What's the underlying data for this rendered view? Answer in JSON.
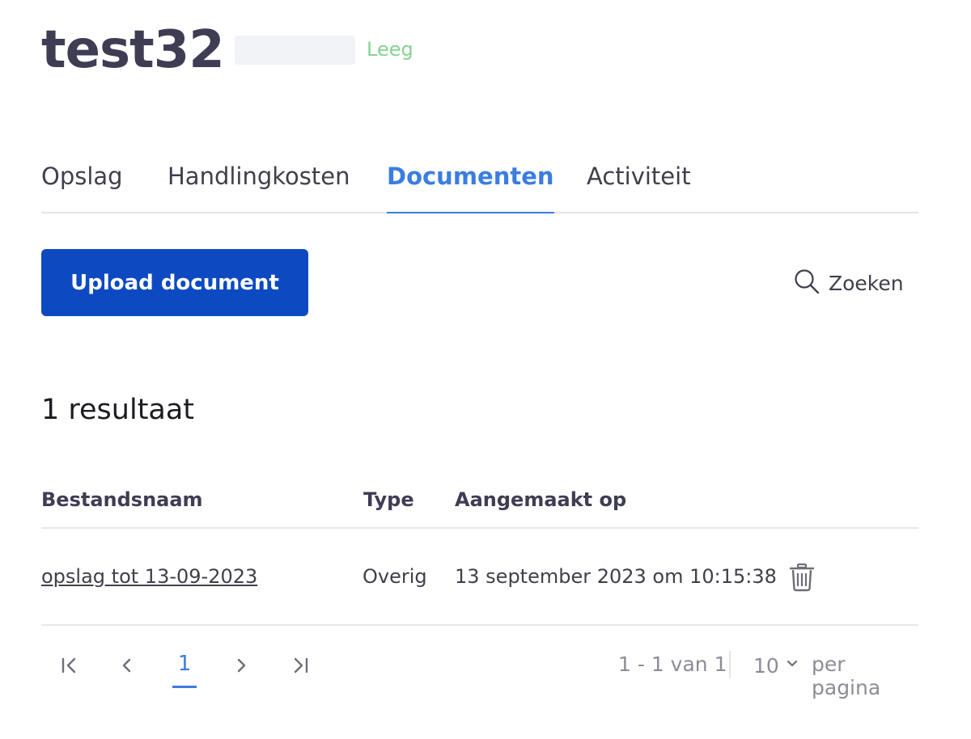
{
  "header": {
    "title": "test32",
    "status": "Leeg"
  },
  "tabs": [
    {
      "label": "Opslag",
      "active": false
    },
    {
      "label": "Handlingkosten",
      "active": false
    },
    {
      "label": "Documenten",
      "active": true
    },
    {
      "label": "Activiteit",
      "active": false
    }
  ],
  "toolbar": {
    "upload_label": "Upload document",
    "search_label": "Zoeken",
    "search_icon": "search-icon"
  },
  "results": {
    "count_label": "1 resultaat"
  },
  "table": {
    "columns": [
      "Bestandsnaam",
      "Type",
      "Aangemaakt op"
    ],
    "rows": [
      {
        "filename": "opslag tot 13-09-2023",
        "type": "Overig",
        "created": "13 september 2023 om 10:15:38",
        "action_icon": "trash-icon"
      }
    ]
  },
  "pagination": {
    "current_page": "1",
    "range_text": "1 - 1 van 1",
    "page_size": "10",
    "per_page_label": "per pagina",
    "icons": [
      "first-page-icon",
      "prev-page-icon",
      "next-page-icon",
      "last-page-icon",
      "chevron-down-icon"
    ]
  },
  "colors": {
    "primary": "#0d4ac2",
    "accent": "#3b7de0",
    "status_green": "#86d391",
    "text": "#3f3f4d",
    "muted": "#8c8c98"
  }
}
